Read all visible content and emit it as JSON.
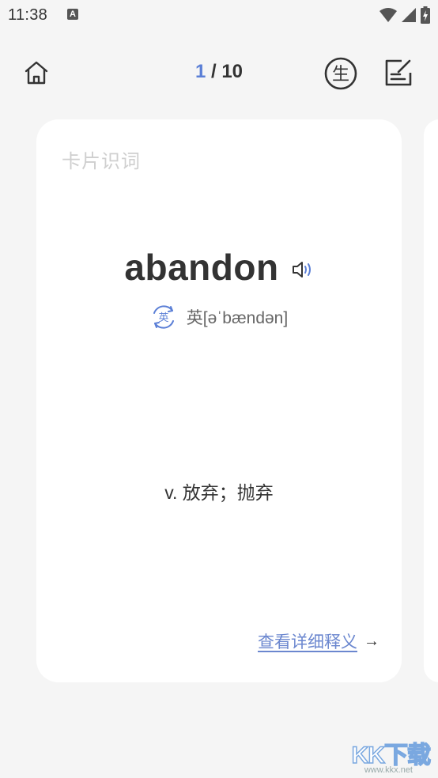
{
  "status_bar": {
    "time": "11:38",
    "notification_icon": "A"
  },
  "nav": {
    "current_page": "1",
    "separator_total": " / 10",
    "learn_icon_label": "生"
  },
  "card": {
    "label": "卡片识词",
    "word": "abandon",
    "phonetic_toggle": "英",
    "phonetic": "英[əˈbændən]",
    "definition": "v. 放弃；抛弃",
    "detail_link": "查看详细释义",
    "arrow": "→"
  },
  "watermark": {
    "text": "KK下载",
    "url": "www.kkx.net"
  },
  "colors": {
    "accent": "#5b7fd6",
    "link": "#6b87cf",
    "background": "#f5f5f5",
    "card": "#ffffff"
  }
}
